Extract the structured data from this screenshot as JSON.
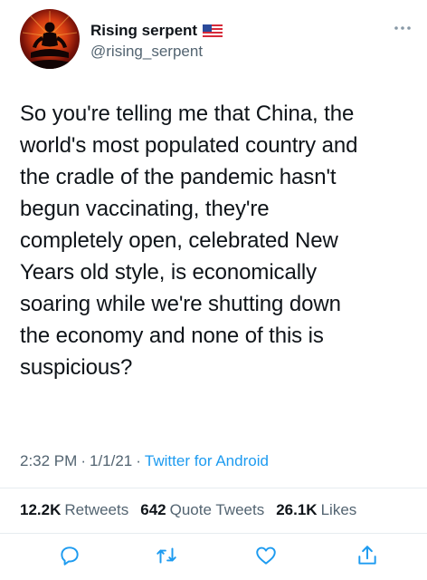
{
  "author": {
    "display_name": "Rising serpent",
    "handle": "@rising_serpent",
    "flag_icon": "us-flag-icon",
    "avatar_icon": "meditating-figure-avatar"
  },
  "tweet": {
    "text": "So you're telling me that China, the\nworld's most populated country and\nthe cradle of the pandemic hasn't\nbegun vaccinating, they're\ncompletely open, celebrated New\nYears old style, is economically\nsoaring while we're shutting down\nthe economy and none of this is\nsuspicious?"
  },
  "meta": {
    "time": "2:32 PM",
    "sep1": "·",
    "date": "1/1/21",
    "sep2": "·",
    "source": "Twitter for Android"
  },
  "stats": {
    "retweets_count": "12.2K",
    "retweets_label": "Retweets",
    "quotes_count": "642",
    "quotes_label": "Quote Tweets",
    "likes_count": "26.1K",
    "likes_label": "Likes"
  },
  "actions": [
    "reply-icon",
    "retweet-icon",
    "like-icon",
    "share-icon"
  ],
  "colors": {
    "text": "#0f1419",
    "secondary": "#536471",
    "link": "#1d9bf0",
    "divider": "#e6ecf0"
  }
}
